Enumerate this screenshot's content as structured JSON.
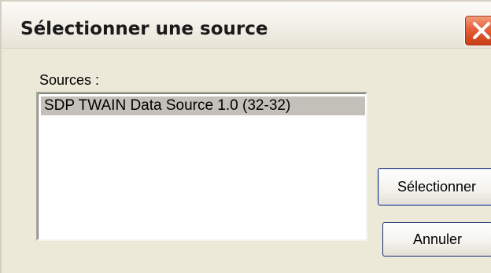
{
  "window": {
    "title": "Sélectionner une source"
  },
  "sources": {
    "label": "Sources :",
    "items": [
      {
        "label": "SDP TWAIN Data Source 1.0 (32-32)",
        "selected": true
      }
    ]
  },
  "buttons": {
    "select_label": "Sélectionner",
    "cancel_label": "Annuler"
  },
  "icons": {
    "close": "close-icon"
  },
  "colors": {
    "close_button": "#e5603a",
    "selection": "#c2c0b8",
    "dialog_background": "#ece9d8"
  }
}
